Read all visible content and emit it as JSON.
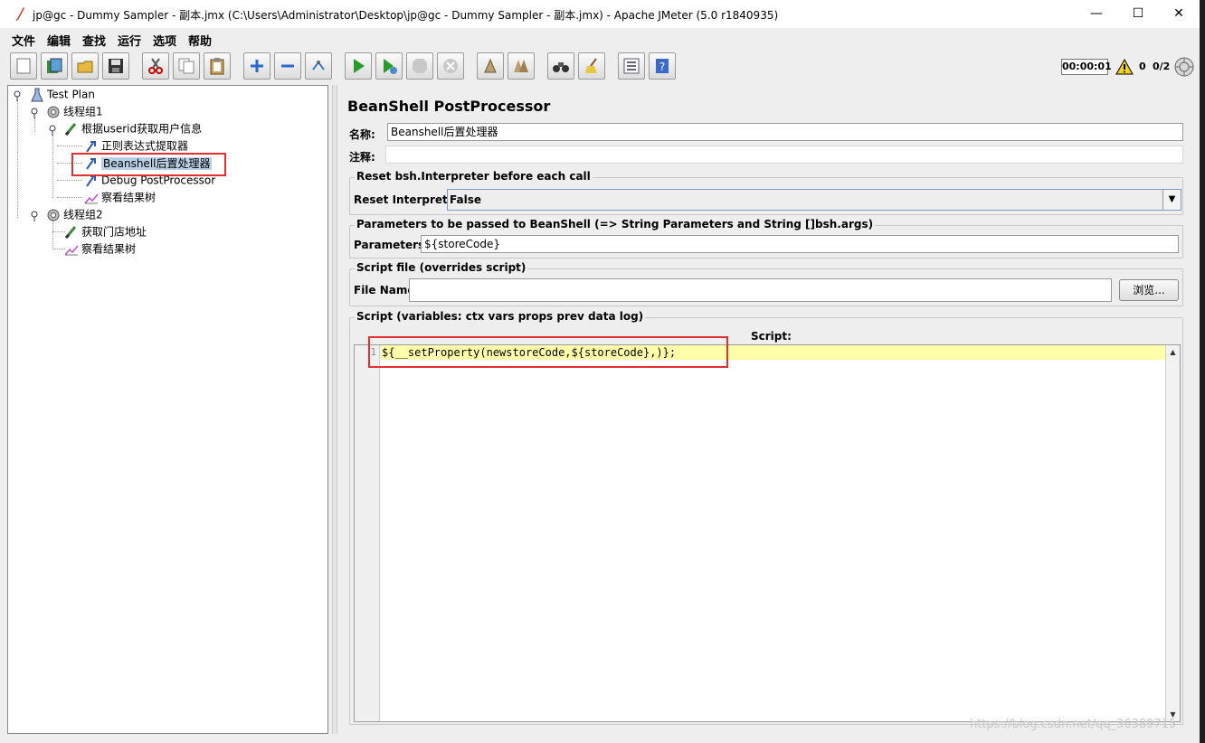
{
  "window": {
    "title": "jp@gc - Dummy Sampler - 副本.jmx (C:\\Users\\Administrator\\Desktop\\jp@gc - Dummy Sampler - 副本.jmx) - Apache JMeter (5.0 r1840935)",
    "minimize": "—",
    "maximize": "☐",
    "close": "✕"
  },
  "menu": [
    "文件",
    "编辑",
    "查找",
    "运行",
    "选项",
    "帮助"
  ],
  "toolbar": {
    "buttons": [
      "new-icon",
      "templates-icon",
      "open-icon",
      "save-icon",
      "cut-icon",
      "copy-icon",
      "paste-icon",
      "expand-icon",
      "collapse-icon",
      "toggle-icon",
      "start-icon",
      "start-no-pause-icon",
      "stop-icon",
      "shutdown-icon",
      "clear-icon",
      "clear-all-icon",
      "search-icon",
      "reset-search-icon",
      "function-helper-icon",
      "help-icon"
    ],
    "timer": "00:00:01",
    "warnings": "0",
    "threads": "0/2"
  },
  "tree": {
    "items": [
      {
        "label": "Test Plan",
        "icon": "test-plan-icon"
      },
      {
        "label": "线程组1",
        "icon": "thread-group-icon"
      },
      {
        "label": "根据userid获取用户信息",
        "icon": "sampler-icon"
      },
      {
        "label": "正则表达式提取器",
        "icon": "post-processor-icon"
      },
      {
        "label": "Beanshell后置处理器",
        "icon": "post-processor-icon",
        "selected": true
      },
      {
        "label": "Debug PostProcessor",
        "icon": "post-processor-icon"
      },
      {
        "label": "察看结果树",
        "icon": "listener-icon"
      },
      {
        "label": "线程组2",
        "icon": "thread-group-icon"
      },
      {
        "label": "获取门店地址",
        "icon": "sampler-icon"
      },
      {
        "label": "察看结果树",
        "icon": "listener-icon"
      }
    ]
  },
  "editor": {
    "panel_title": "BeanShell PostProcessor",
    "name_label": "名称:",
    "name_value": "Beanshell后置处理器",
    "comment_label": "注释:",
    "comment_value": "",
    "reset_group": "Reset bsh.Interpreter before each call",
    "reset_label": "Reset Interpreter:",
    "reset_value": "False",
    "params_group": "Parameters to be passed to BeanShell (=> String Parameters and String []bsh.args)",
    "params_label": "Parameters:",
    "params_value": "${storeCode}",
    "file_group": "Script file (overrides script)",
    "file_label": "File Name:",
    "file_value": "",
    "browse_button": "浏览...",
    "script_group": "Script (variables: ctx vars props prev data log)",
    "script_label": "Script:",
    "script_line_number": "1",
    "script_code": "${__setProperty(newstoreCode,${storeCode},)};"
  },
  "watermark": "https://blog.csdn.net/qq_36389715",
  "colors": {
    "highlight_box": "#e03030",
    "current_line": "#ffffaa",
    "selection": "#b8cfe5"
  }
}
